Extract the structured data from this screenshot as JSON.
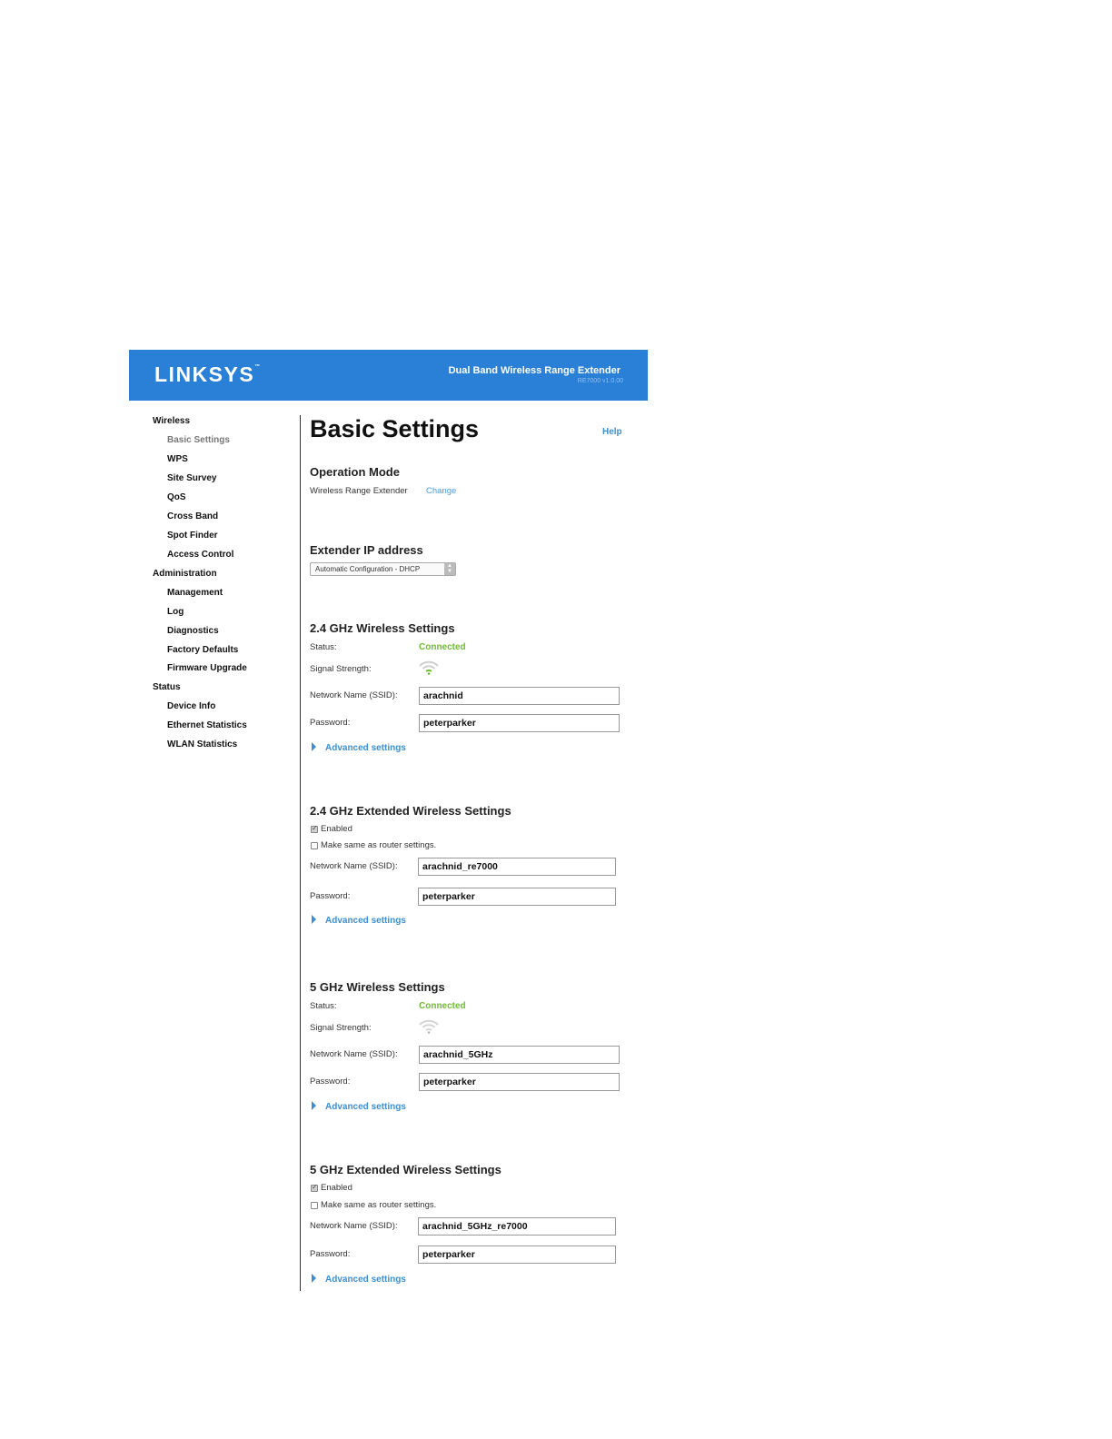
{
  "header": {
    "logo": "LINKSYS",
    "product": "Dual Band Wireless Range Extender",
    "model": "RE7000 v1.0.00",
    "brand_color": "#2a7fd7"
  },
  "sidebar": {
    "groups": [
      {
        "label": "Wireless",
        "items": [
          "Basic Settings",
          "WPS",
          "Site Survey",
          "QoS",
          "Cross Band",
          "Spot Finder",
          "Access Control"
        ]
      },
      {
        "label": "Administration",
        "items": [
          "Management",
          "Log",
          "Diagnostics",
          "Factory Defaults",
          "Firmware Upgrade"
        ]
      },
      {
        "label": "Status",
        "items": [
          "Device Info",
          "Ethernet Statistics",
          "WLAN Statistics"
        ]
      }
    ],
    "active_item": "Basic Settings"
  },
  "main": {
    "title": "Basic Settings",
    "help": "Help",
    "operation_mode": {
      "heading": "Operation Mode",
      "value": "Wireless Range Extender",
      "change": "Change"
    },
    "extender_ip": {
      "heading": "Extender IP address",
      "selected": "Automatic Configuration - DHCP"
    },
    "ghz24": {
      "heading": "2.4 GHz Wireless Settings",
      "status_label": "Status:",
      "status_value": "Connected",
      "signal_label": "Signal Strength:",
      "signal_icon": "wifi-signal-icon",
      "ssid_label": "Network Name (SSID):",
      "ssid": "arachnid",
      "password_label": "Password:",
      "password": "peterparker",
      "advanced": "Advanced settings"
    },
    "ghz24_ext": {
      "heading": "2.4 GHz Extended Wireless Settings",
      "enabled_label": "Enabled",
      "same_label": "Make same as router settings.",
      "ssid_label": "Network Name (SSID):",
      "ssid": "arachnid_re7000",
      "password_label": "Password:",
      "password": "peterparker",
      "advanced": "Advanced settings"
    },
    "ghz5": {
      "heading": "5 GHz Wireless Settings",
      "status_label": "Status:",
      "status_value": "Connected",
      "signal_label": "Signal Strength:",
      "signal_icon": "wifi-signal-icon",
      "ssid_label": "Network Name (SSID):",
      "ssid": "arachnid_5GHz",
      "password_label": "Password:",
      "password": "peterparker",
      "advanced": "Advanced settings"
    },
    "ghz5_ext": {
      "heading": "5 GHz Extended Wireless Settings",
      "enabled_label": "Enabled",
      "same_label": "Make same as router settings.",
      "ssid_label": "Network Name (SSID):",
      "ssid": "arachnid_5GHz_re7000",
      "password_label": "Password:",
      "password": "peterparker",
      "advanced": "Advanced settings"
    }
  },
  "colors": {
    "connected": "#6fbf2f",
    "link": "#3a8fd8"
  }
}
